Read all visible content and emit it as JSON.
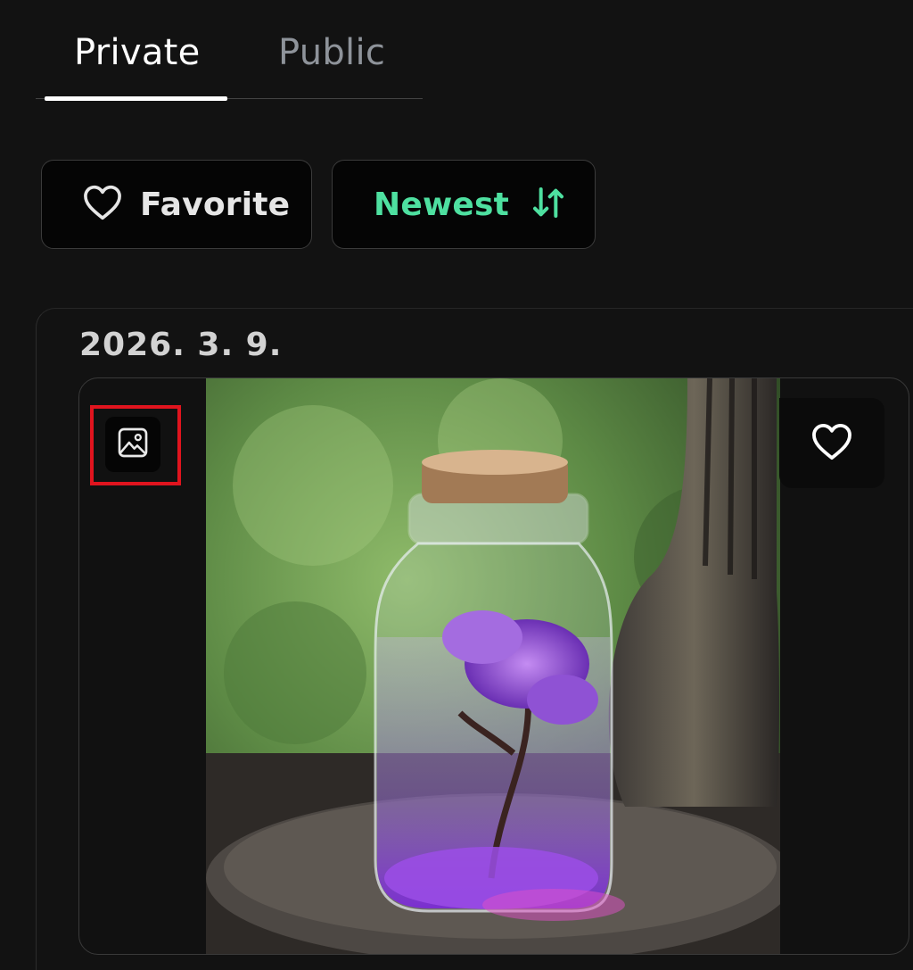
{
  "tabs": [
    {
      "label": "Private",
      "active": true
    },
    {
      "label": "Public",
      "active": false
    }
  ],
  "filters": {
    "favorite_label": "Favorite",
    "sort_label": "Newest"
  },
  "group": {
    "date": "2026. 3. 9."
  },
  "card": {
    "type_icon": "image-icon",
    "favorite_icon": "heart-outline-icon",
    "image_alt": "Glass bottle with cork containing a purple blossoming tree"
  },
  "colors": {
    "background": "#121212",
    "accent_green": "#4ee0a0",
    "highlight_red": "#e0141e"
  }
}
